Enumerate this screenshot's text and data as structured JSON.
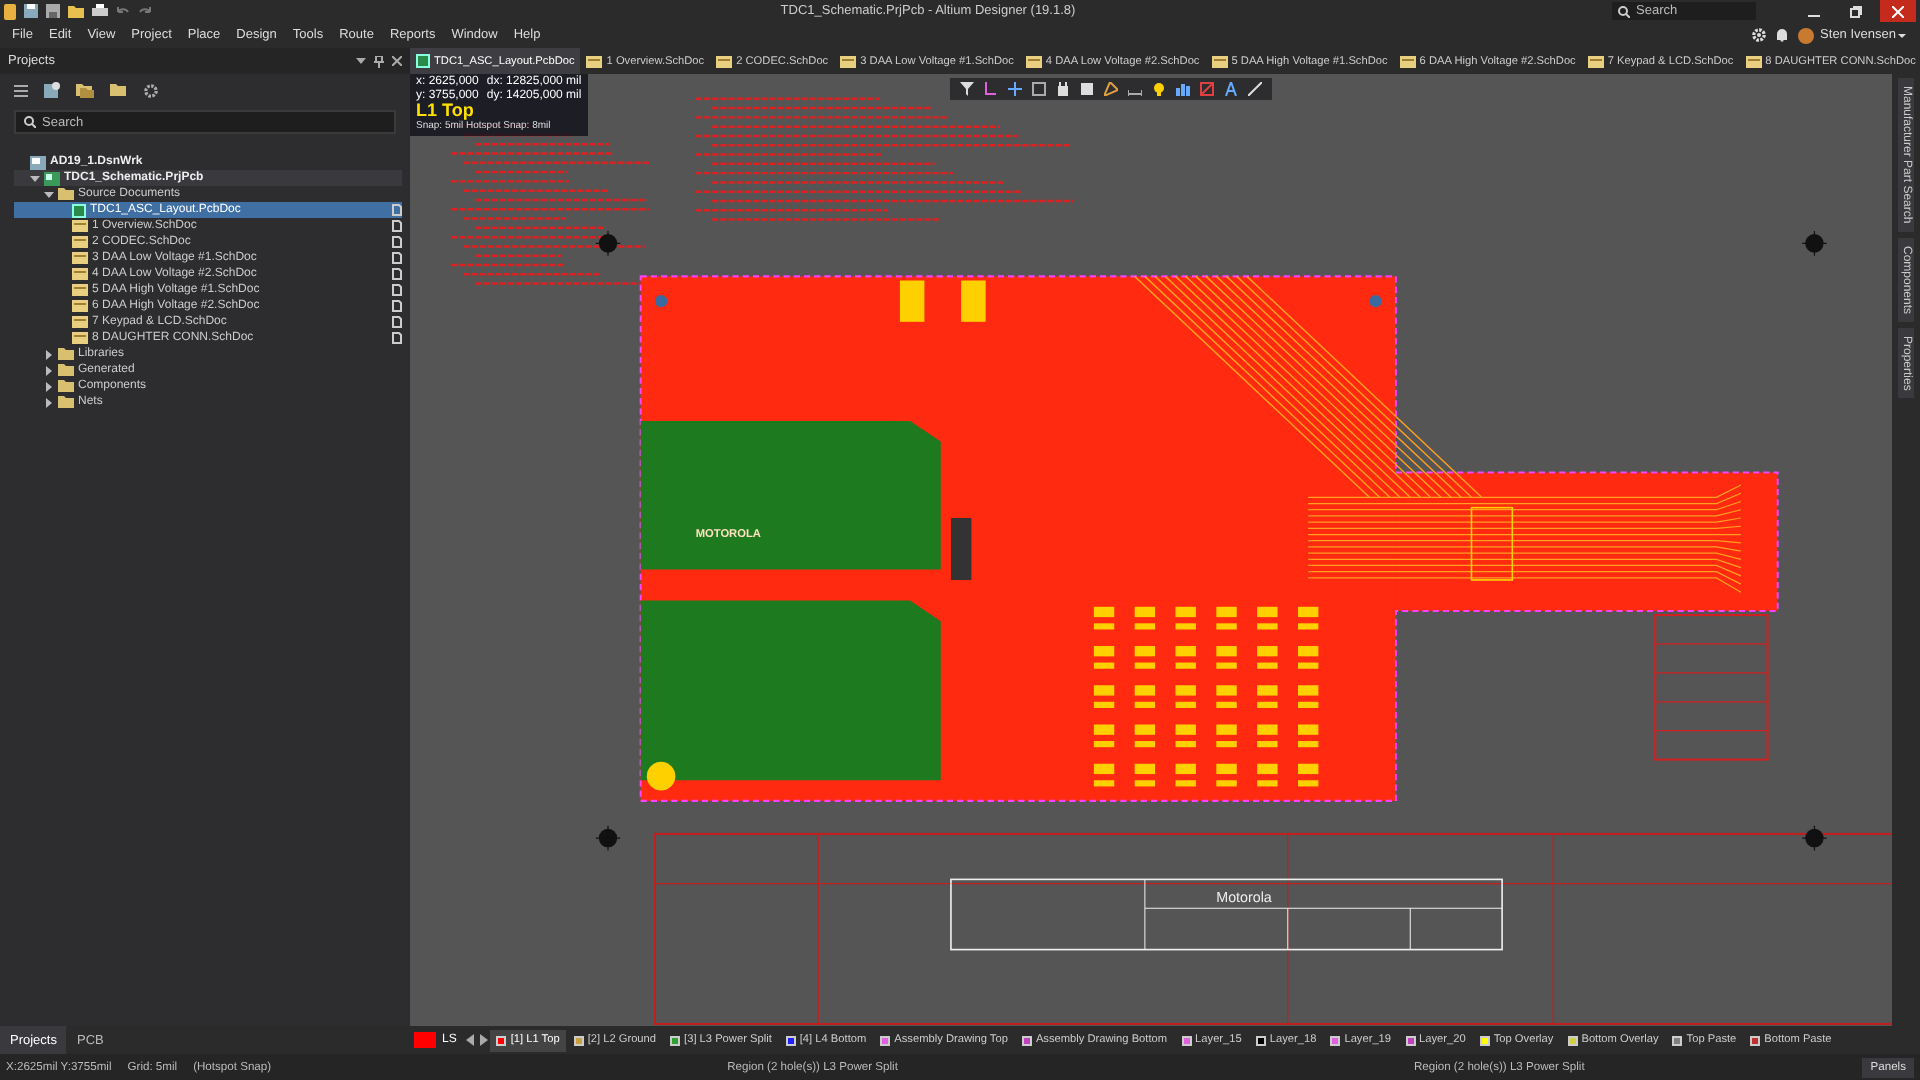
{
  "title_bar": {
    "title": "TDC1_Schematic.PrjPcb - Altium Designer (19.1.8)",
    "search": {
      "placeholder": "Search"
    }
  },
  "menu": [
    "File",
    "Edit",
    "View",
    "Project",
    "Place",
    "Design",
    "Tools",
    "Route",
    "Reports",
    "Window",
    "Help"
  ],
  "user": {
    "name": "Sten Ivensen"
  },
  "projects_panel": {
    "title": "Projects",
    "search": {
      "placeholder": "Search"
    },
    "tree": [
      {
        "label": "AD19_1.DsnWrk",
        "kind": "workspace",
        "selected": false,
        "children": [
          {
            "label": "TDC1_Schematic.PrjPcb",
            "kind": "project",
            "expanded": true,
            "selected": false,
            "children": [
              {
                "label": "Source Documents",
                "kind": "folder",
                "expanded": true,
                "selected": false,
                "children": [
                  {
                    "label": "TDC1_ASC_Layout.PcbDoc",
                    "kind": "pcb",
                    "selected": true
                  },
                  {
                    "label": "1 Overview.SchDoc",
                    "kind": "sch",
                    "selected": false
                  },
                  {
                    "label": "2 CODEC.SchDoc",
                    "kind": "sch",
                    "selected": false
                  },
                  {
                    "label": "3 DAA Low Voltage #1.SchDoc",
                    "kind": "sch",
                    "selected": false
                  },
                  {
                    "label": "4 DAA Low Voltage #2.SchDoc",
                    "kind": "sch",
                    "selected": false
                  },
                  {
                    "label": "5 DAA High Voltage #1.SchDoc",
                    "kind": "sch",
                    "selected": false
                  },
                  {
                    "label": "6 DAA High Voltage #2.SchDoc",
                    "kind": "sch",
                    "selected": false
                  },
                  {
                    "label": "7 Keypad & LCD.SchDoc",
                    "kind": "sch",
                    "selected": false
                  },
                  {
                    "label": "8 DAUGHTER CONN.SchDoc",
                    "kind": "sch",
                    "selected": false
                  }
                ]
              },
              {
                "label": "Libraries",
                "kind": "folder",
                "expanded": false,
                "selected": false
              },
              {
                "label": "Generated",
                "kind": "folder",
                "expanded": false,
                "selected": false
              },
              {
                "label": "Components",
                "kind": "folder",
                "expanded": false,
                "selected": false
              },
              {
                "label": "Nets",
                "kind": "folder",
                "expanded": false,
                "selected": false
              }
            ]
          }
        ]
      }
    ]
  },
  "document_tabs": [
    {
      "label": "TDC1_ASC_Layout.PcbDoc",
      "kind": "pcb",
      "selected": true
    },
    {
      "label": "1 Overview.SchDoc",
      "kind": "sch",
      "selected": false
    },
    {
      "label": "2 CODEC.SchDoc",
      "kind": "sch",
      "selected": false
    },
    {
      "label": "3 DAA Low Voltage #1.SchDoc",
      "kind": "sch",
      "selected": false
    },
    {
      "label": "4 DAA Low Voltage #2.SchDoc",
      "kind": "sch",
      "selected": false
    },
    {
      "label": "5 DAA High Voltage #1.SchDoc",
      "kind": "sch",
      "selected": false
    },
    {
      "label": "6 DAA High Voltage #2.SchDoc",
      "kind": "sch",
      "selected": false
    },
    {
      "label": "7 Keypad & LCD.SchDoc",
      "kind": "sch",
      "selected": false
    },
    {
      "label": "8 DAUGHTER CONN.SchDoc",
      "kind": "sch",
      "selected": false
    }
  ],
  "canvas": {
    "coordinates": {
      "x": "x: 2625,000",
      "dx": "dx: 12825,000 mil",
      "y": "y: 3755,000",
      "dy": "dy: 14205,000 mil",
      "layer": "L1 Top",
      "snap": "Snap: 5mil Hotspot Snap: 8mil"
    },
    "board_logo": "MOTOROLA",
    "title_block_company": "Motorola"
  },
  "side_panels": [
    "Manufacturer Part Search",
    "Components",
    "Properties"
  ],
  "panel_tabs": [
    {
      "label": "Projects",
      "selected": true
    },
    {
      "label": "PCB",
      "selected": false
    }
  ],
  "layers": {
    "current": {
      "label": "LS",
      "color": "#ff0000"
    },
    "tabs": [
      {
        "label": "[1] L1 Top",
        "color": "#ff0000",
        "selected": true
      },
      {
        "label": "[2] L2 Ground",
        "color": "#c8a040",
        "selected": false
      },
      {
        "label": "[3] L3 Power Split",
        "color": "#30a030",
        "selected": false
      },
      {
        "label": "[4] L4 Bottom",
        "color": "#2020ff",
        "selected": false
      },
      {
        "label": "Assembly Drawing Top",
        "color": "#e060e0",
        "selected": false
      },
      {
        "label": "Assembly Drawing Bottom",
        "color": "#c040c0",
        "selected": false
      },
      {
        "label": "Layer_15",
        "color": "#e060e0",
        "selected": false
      },
      {
        "label": "Layer_18",
        "color": "#000000",
        "selected": false
      },
      {
        "label": "Layer_19",
        "color": "#e060e0",
        "selected": false
      },
      {
        "label": "Layer_20",
        "color": "#c040c0",
        "selected": false
      },
      {
        "label": "Top Overlay",
        "color": "#ffff00",
        "selected": false
      },
      {
        "label": "Bottom Overlay",
        "color": "#d0d040",
        "selected": false
      },
      {
        "label": "Top Paste",
        "color": "#808080",
        "selected": false
      },
      {
        "label": "Bottom Paste",
        "color": "#c03030",
        "selected": false
      }
    ]
  },
  "status_bar": {
    "position": "X:2625mil Y:3755mil",
    "grid": "Grid: 5mil",
    "snap": "(Hotspot Snap)",
    "hover_left": "Region (2 hole(s)) L3 Power Split",
    "hover_right": "Region (2 hole(s)) L3 Power Split",
    "panels_button": "Panels"
  }
}
